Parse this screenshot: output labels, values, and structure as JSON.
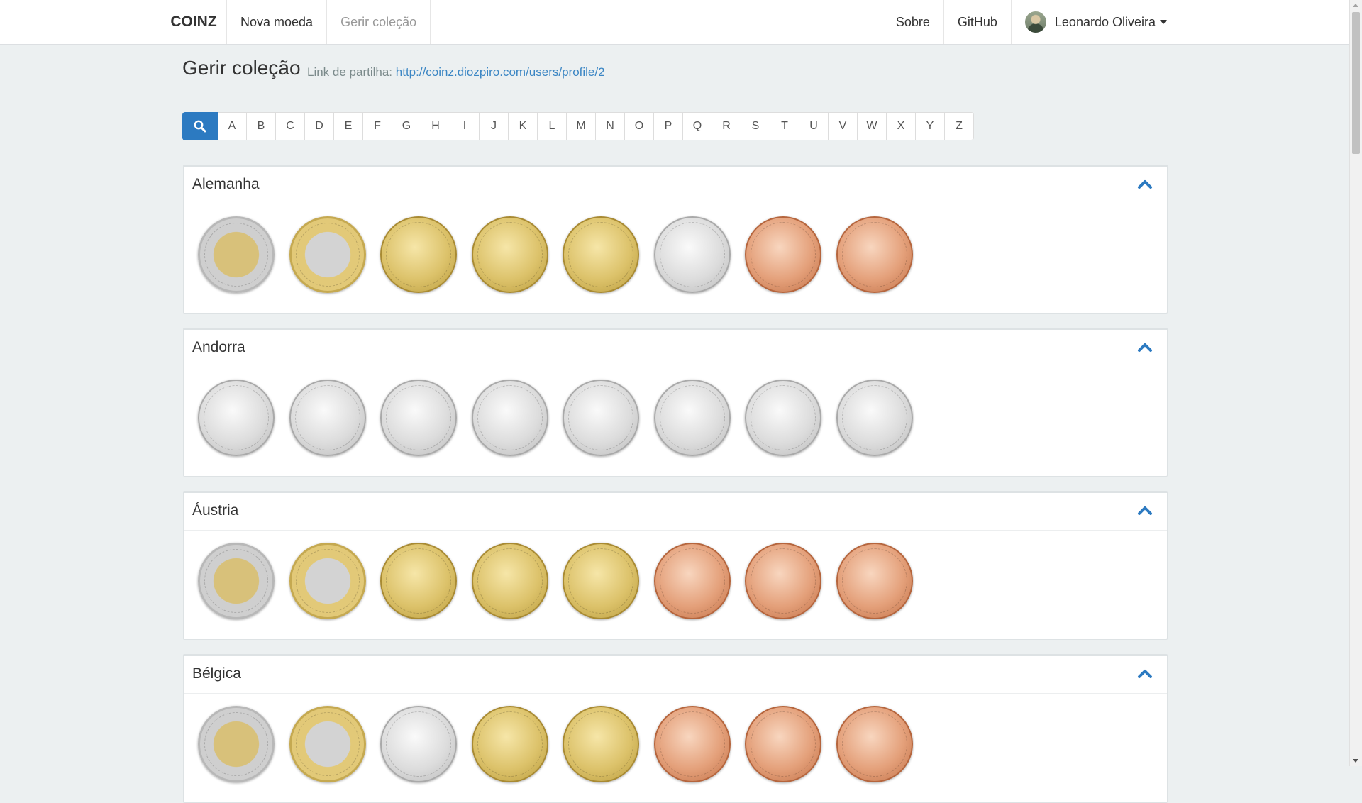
{
  "navbar": {
    "brand": "COINZ",
    "left_items": [
      {
        "label": "Nova moeda",
        "active": false
      },
      {
        "label": "Gerir coleção",
        "active": true
      }
    ],
    "right_items": [
      {
        "label": "Sobre"
      },
      {
        "label": "GitHub"
      }
    ],
    "user": {
      "name": "Leonardo Oliveira"
    }
  },
  "header": {
    "title": "Gerir coleção",
    "share_label": "Link de partilha:",
    "share_link": "http://coinz.diozpiro.com/users/profile/2"
  },
  "letters": [
    "A",
    "B",
    "C",
    "D",
    "E",
    "F",
    "G",
    "H",
    "I",
    "J",
    "K",
    "L",
    "M",
    "N",
    "O",
    "P",
    "Q",
    "R",
    "S",
    "T",
    "U",
    "V",
    "W",
    "X",
    "Y",
    "Z"
  ],
  "colors": {
    "primary": "#2c7ac1",
    "link": "#3b86c4",
    "page_bg": "#ecf0f1"
  },
  "countries": [
    {
      "name": "Alemanha",
      "coins": [
        "bi-gold-rim",
        "bi-silver-rim",
        "gold",
        "gold",
        "gold",
        "silver",
        "copper",
        "copper"
      ]
    },
    {
      "name": "Andorra",
      "coins": [
        "silver",
        "silver",
        "silver",
        "silver",
        "silver",
        "silver",
        "silver",
        "silver"
      ]
    },
    {
      "name": "Áustria",
      "coins": [
        "bi-gold-rim",
        "bi-silver-rim",
        "gold",
        "gold",
        "gold",
        "copper",
        "copper",
        "copper"
      ]
    },
    {
      "name": "Bélgica",
      "coins": [
        "bi-gold-rim",
        "bi-silver-rim",
        "silver",
        "gold",
        "gold",
        "copper",
        "copper",
        "copper"
      ]
    }
  ],
  "icons": {
    "search": "search-icon",
    "collapse": "chevron-up-icon",
    "user_menu": "caret-down-icon"
  }
}
